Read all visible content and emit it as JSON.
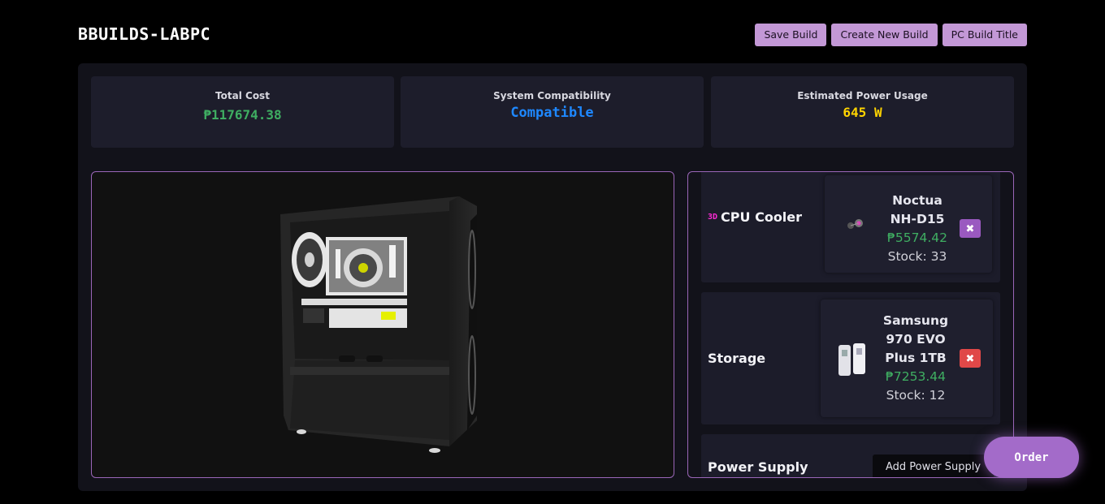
{
  "brand": "BBUILDS-LABPC",
  "header": {
    "save_label": "Save Build",
    "new_label": "Create New Build",
    "title_label": "PC Build Title"
  },
  "stats": {
    "cost_label": "Total Cost",
    "cost_value": "₱117674.38",
    "compat_label": "System Compatibility",
    "compat_value": "Compatible",
    "power_label": "Estimated Power Usage",
    "power_value": "645 W"
  },
  "colors": {
    "accent": "#c398d6",
    "cost": "#3fae62",
    "compatible": "#1e88ff",
    "power": "#ffd400",
    "remove_purple": "#9a59c0",
    "remove_red": "#e04848"
  },
  "parts": [
    {
      "category": "CPU Cooler",
      "badge": "3D",
      "name_lines": [
        "Noctua",
        "NH-D15"
      ],
      "price": "₱5574.42",
      "stock": "Stock: 33",
      "remove_glyph": "✖",
      "icon": "cpu-cooler-thumbnail"
    },
    {
      "category": "Storage",
      "name_lines": [
        "Samsung",
        "970 EVO",
        "Plus 1TB"
      ],
      "price": "₱7253.44",
      "stock": "Stock: 12",
      "remove_glyph": "✖",
      "icon": "storage-thumbnail"
    },
    {
      "category": "Power Supply",
      "add_label": "Add Power Supply"
    }
  ],
  "order_label": "Order"
}
